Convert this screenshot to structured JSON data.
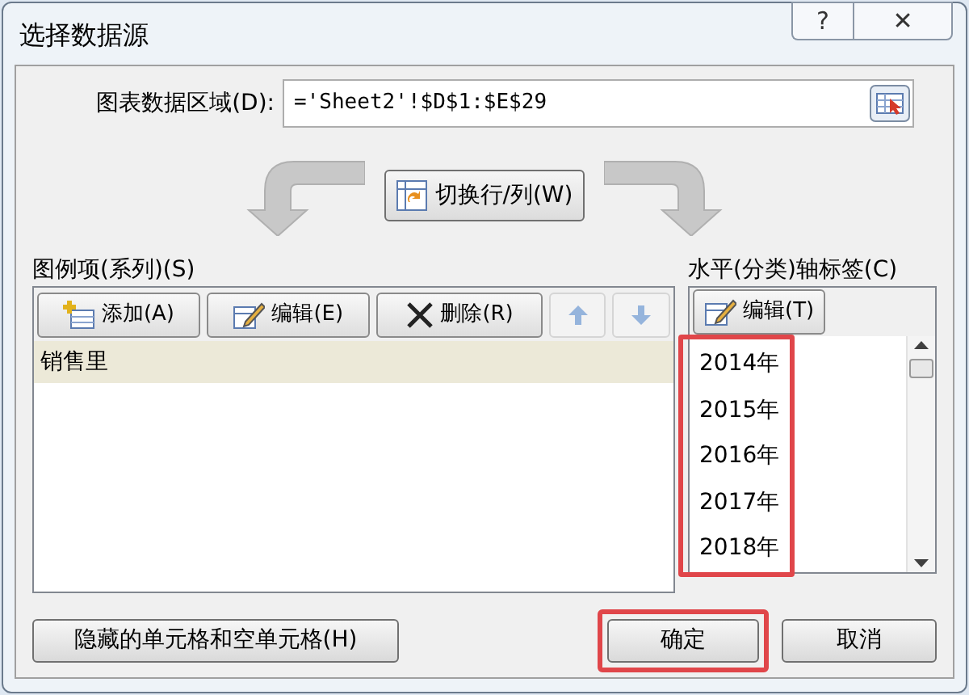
{
  "window": {
    "title": "选择数据源"
  },
  "title_buttons": [
    {
      "kind": "help",
      "label": "?"
    },
    {
      "kind": "close",
      "label": "✕"
    }
  ],
  "data_range": {
    "label": "图表数据区域(D):",
    "value": "='Sheet2'!$D$1:$E$29"
  },
  "switch_button": {
    "label": "切换行/列(W)"
  },
  "series_panel": {
    "label": "图例项(系列)(S)",
    "toolbar": [
      {
        "kind": "add",
        "label": "添加(A)",
        "disabled": false
      },
      {
        "kind": "edit",
        "label": "编辑(E)",
        "disabled": false
      },
      {
        "kind": "delete",
        "label": "删除(R)",
        "disabled": false
      },
      {
        "kind": "up",
        "disabled": true
      },
      {
        "kind": "down",
        "disabled": true
      }
    ],
    "items": [
      {
        "label": "销售里",
        "selected": true
      }
    ]
  },
  "category_panel": {
    "label": "水平(分类)轴标签(C)",
    "edit_button": {
      "label": "编辑(T)"
    },
    "highlighted": true,
    "items": [
      {
        "label": "2014年"
      },
      {
        "label": "2015年"
      },
      {
        "label": "2016年"
      },
      {
        "label": "2017年"
      },
      {
        "label": "2018年"
      }
    ]
  },
  "buttons": [
    {
      "kind": "hidden_cells",
      "label": "隐藏的单元格和空单元格(H)",
      "highlighted": false
    },
    {
      "kind": "ok",
      "label": "确定",
      "highlighted": true
    },
    {
      "kind": "cancel",
      "label": "取消",
      "highlighted": false
    }
  ]
}
